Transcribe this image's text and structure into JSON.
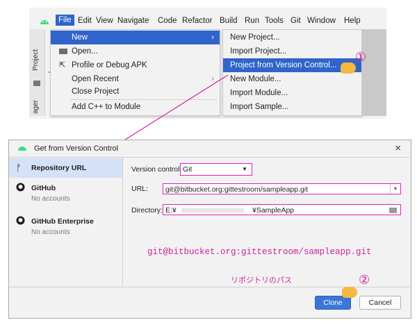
{
  "ide": {
    "menu": [
      "File",
      "Edit",
      "View",
      "Navigate",
      "Code",
      "Refactor",
      "Build",
      "Run",
      "Tools",
      "Git",
      "Window",
      "Help"
    ],
    "side_tabs": [
      "Project",
      "ager"
    ],
    "file_menu": {
      "items": [
        {
          "label": "New",
          "selected": true,
          "has_submenu": true
        },
        {
          "label": "Open...",
          "icon": "folder-icon"
        },
        {
          "label": "Profile or Debug APK",
          "icon": "profile-icon"
        },
        {
          "label": "Open Recent",
          "has_submenu": true
        },
        {
          "label": "Close Project"
        },
        {
          "label": "Add C++ to Module"
        }
      ]
    },
    "new_submenu": {
      "items": [
        {
          "label": "New Project..."
        },
        {
          "label": "Import Project..."
        },
        {
          "label": "Project from Version Control...",
          "selected": true
        },
        {
          "label": "New Module..."
        },
        {
          "label": "Import Module..."
        },
        {
          "label": "Import Sample..."
        }
      ]
    }
  },
  "dialog": {
    "title": "Get from Version Control",
    "sidebar": [
      {
        "label": "Repository URL",
        "sub": "",
        "icon": "branch-icon",
        "selected": true
      },
      {
        "label": "GitHub",
        "sub": "No accounts",
        "icon": "github-icon"
      },
      {
        "label": "GitHub Enterprise",
        "sub": "No accounts",
        "icon": "github-icon"
      }
    ],
    "version_control_label": "Version control:",
    "version_control_value": "Git",
    "url_label": "URL:",
    "url_value": "git@bitbucket.org:gittestroom/sampleapp.git",
    "directory_label": "Directory:",
    "directory_prefix": "E:¥",
    "directory_suffix": "¥SampleApp",
    "clone_button": "Clone",
    "cancel_button": "Cancel"
  },
  "annotations": {
    "step1": "①",
    "step2": "②",
    "repo_path": "git@bitbucket.org:gittestroom/sampleapp.git",
    "repo_caption": "リポジトリのパス"
  },
  "colors": {
    "accent": "#2f65ca",
    "annotation": "#d0209e",
    "primary_button": "#3b76d8"
  }
}
